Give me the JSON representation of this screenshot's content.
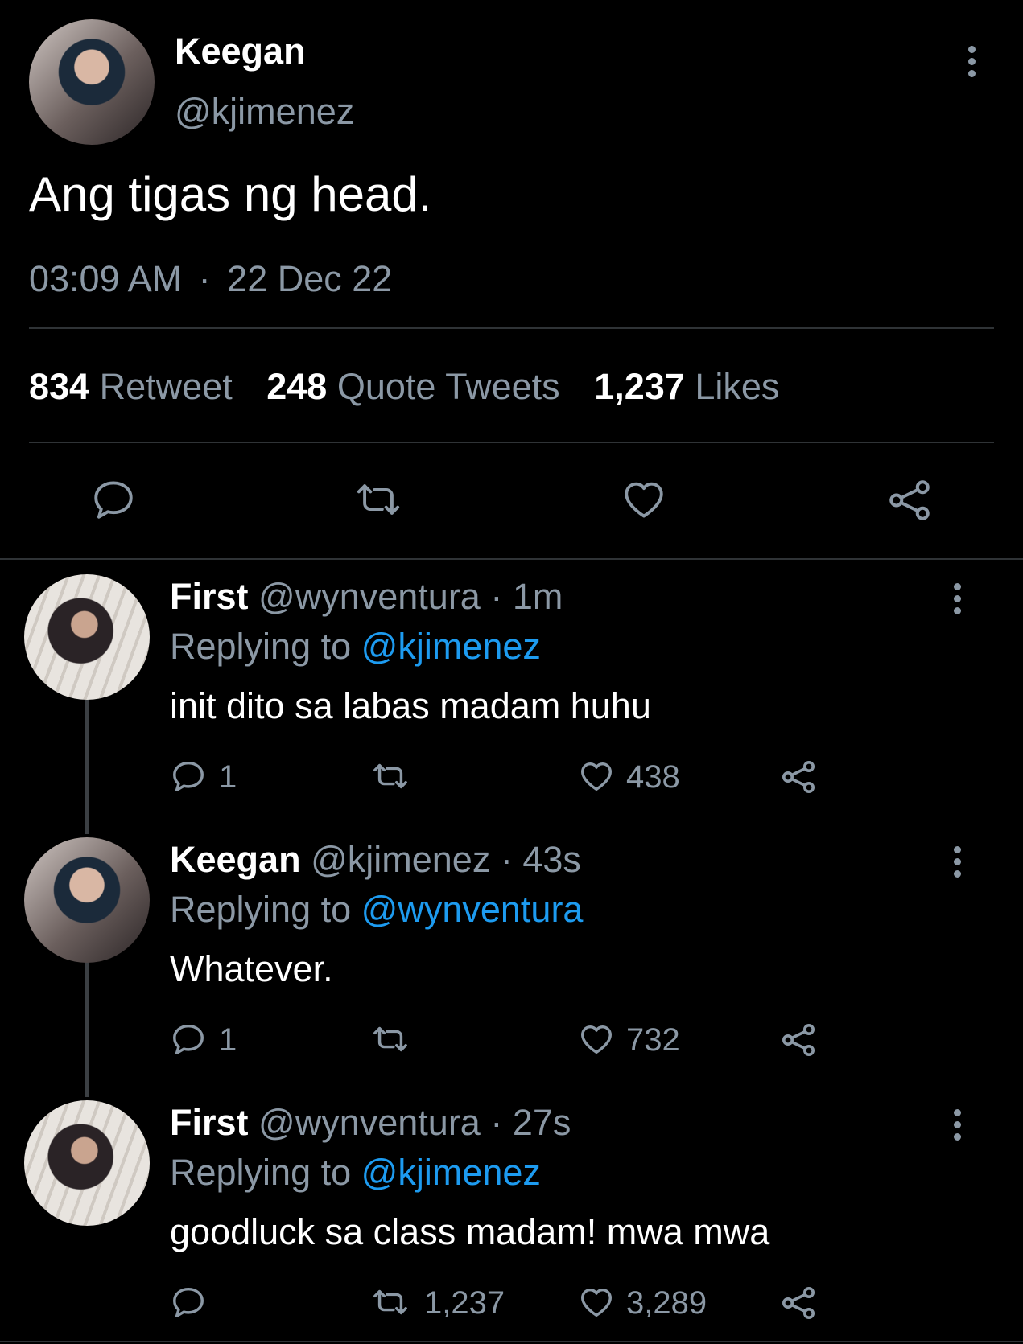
{
  "tweet": {
    "name": "Keegan",
    "handle": "@kjimenez",
    "text": "Ang tigas ng head.",
    "time": "03:09 AM",
    "separator": "·",
    "date": "22 Dec 22",
    "stats": {
      "retweets": "834",
      "retweets_label": "Retweet",
      "quotes": "248",
      "quotes_label": "Quote Tweets",
      "likes": "1,237",
      "likes_label": "Likes"
    }
  },
  "replies": [
    {
      "name": "First",
      "handle": "@wynventura",
      "time": "· 1m",
      "replying_prefix": "Replying to",
      "replying_to": "@kjimenez",
      "text": "init dito sa labas madam huhu",
      "reply_count": "1",
      "retweet_count": "",
      "like_count": "438"
    },
    {
      "name": "Keegan",
      "handle": "@kjimenez",
      "time": "· 43s",
      "replying_prefix": "Replying to",
      "replying_to": "@wynventura",
      "text": "Whatever.",
      "reply_count": "1",
      "retweet_count": "",
      "like_count": "732"
    },
    {
      "name": "First",
      "handle": "@wynventura",
      "time": "· 27s",
      "replying_prefix": "Replying to",
      "replying_to": "@kjimenez",
      "text": "goodluck sa class madam! mwa mwa",
      "reply_count": "",
      "retweet_count": "1,237",
      "like_count": "3,289"
    }
  ],
  "icons": [
    "more-icon",
    "reply-icon",
    "retweet-icon",
    "like-icon",
    "share-icon"
  ]
}
